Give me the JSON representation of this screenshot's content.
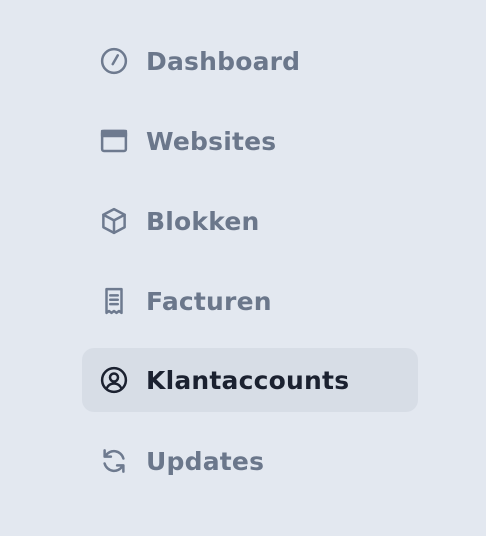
{
  "nav": {
    "items": [
      {
        "label": "Dashboard",
        "icon": "dashboard-gauge-icon",
        "active": false
      },
      {
        "label": "Websites",
        "icon": "browser-window-icon",
        "active": false
      },
      {
        "label": "Blokken",
        "icon": "cube-icon",
        "active": false
      },
      {
        "label": "Facturen",
        "icon": "receipt-icon",
        "active": false
      },
      {
        "label": "Klantaccounts",
        "icon": "user-circle-icon",
        "active": true
      },
      {
        "label": "Updates",
        "icon": "refresh-icon",
        "active": false
      }
    ]
  }
}
